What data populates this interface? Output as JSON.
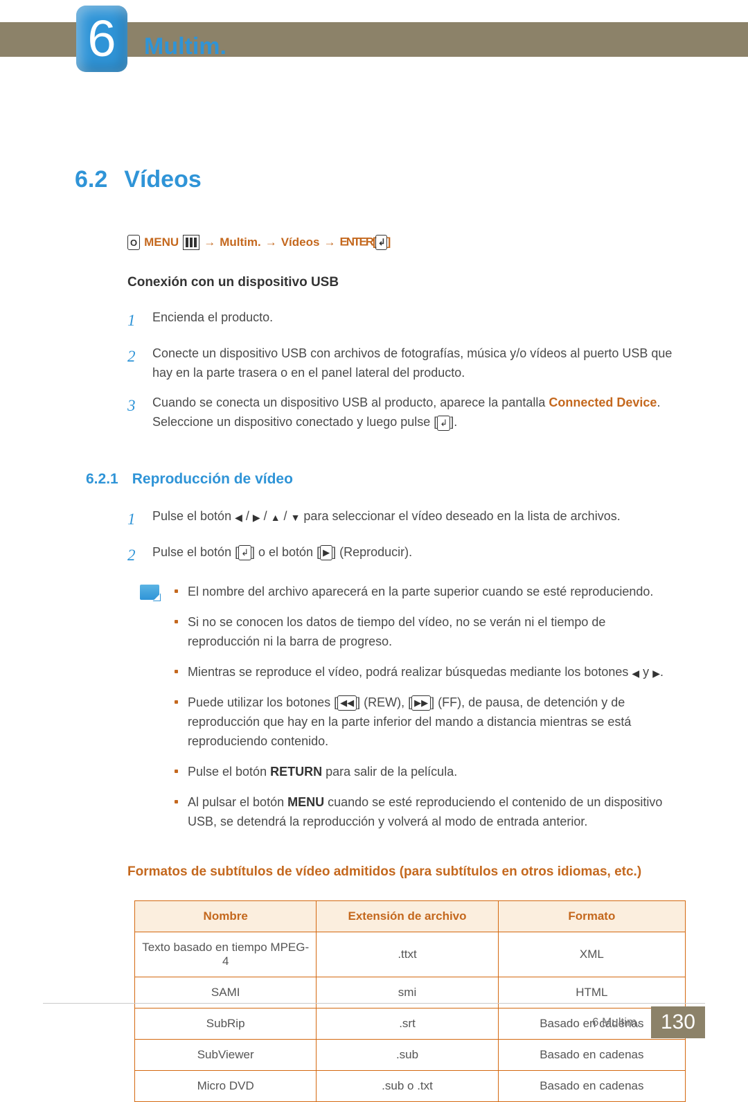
{
  "header": {
    "chapter_number": "6",
    "chapter_title": "Multim."
  },
  "section": {
    "number": "6.2",
    "title": "Vídeos"
  },
  "nav_path": {
    "osd_label": "O",
    "menu": "MENU",
    "arrow": "→",
    "seg1": "Multim.",
    "seg2": "Vídeos",
    "seg3": "ENTER["
  },
  "usb": {
    "title": "Conexión con un dispositivo USB",
    "steps": [
      {
        "n": "1",
        "text": "Encienda el producto."
      },
      {
        "n": "2",
        "text": "Conecte un dispositivo USB con archivos de fotografías, música y/o vídeos al puerto USB que hay en la parte trasera o en el panel lateral del producto."
      },
      {
        "n": "3",
        "text_a": "Cuando se conecta un dispositivo USB al producto, aparece la pantalla ",
        "connected": "Connected Device",
        "text_b": ". Seleccione un dispositivo conectado y luego pulse [",
        "text_c": "]."
      }
    ]
  },
  "playback": {
    "number": "6.2.1",
    "title": "Reproducción de vídeo",
    "steps": [
      {
        "n": "1",
        "pre": "Pulse el botón ",
        "mid": " para seleccionar el vídeo deseado en la lista de archivos."
      },
      {
        "n": "2",
        "pre": "Pulse el botón [",
        "mid": "] o el botón [",
        "post": "] (Reproducir)."
      }
    ],
    "notes": [
      "El nombre del archivo aparecerá en la parte superior cuando se esté reproduciendo.",
      "Si no se conocen los datos de tiempo del vídeo, no se verán ni el tiempo de reproducción ni la barra de progreso.",
      {
        "a": "Mientras se reproduce el vídeo, podrá realizar búsquedas mediante los botones ",
        "b": " y ",
        "c": "."
      },
      {
        "a": "Puede utilizar los botones [",
        "b": "] (REW), [",
        "c": "] (FF), de pausa, de detención y de reproducción que hay en la parte inferior del mando a distancia mientras se está reproduciendo contenido."
      },
      {
        "a": "Pulse el botón ",
        "ret": "RETURN",
        "b": " para salir de la película."
      },
      {
        "a": "Al pulsar el botón ",
        "menu": "MENU",
        "b": " cuando se esté reproduciendo el contenido de un dispositivo USB, se detendrá la reproducción y volverá al modo de entrada anterior."
      }
    ]
  },
  "subtable": {
    "heading": "Formatos de subtítulos de vídeo admitidos (para subtítulos en otros idiomas, etc.)",
    "headers": [
      "Nombre",
      "Extensión de archivo",
      "Formato"
    ],
    "rows": [
      [
        "Texto basado en tiempo MPEG-4",
        ".ttxt",
        "XML"
      ],
      [
        "SAMI",
        "smi",
        "HTML"
      ],
      [
        "SubRip",
        ".srt",
        "Basado en cadenas"
      ],
      [
        "SubViewer",
        ".sub",
        "Basado en cadenas"
      ],
      [
        "Micro DVD",
        ".sub o .txt",
        "Basado en cadenas"
      ]
    ]
  },
  "footer": {
    "ref": "6 Multim.",
    "page": "130"
  }
}
